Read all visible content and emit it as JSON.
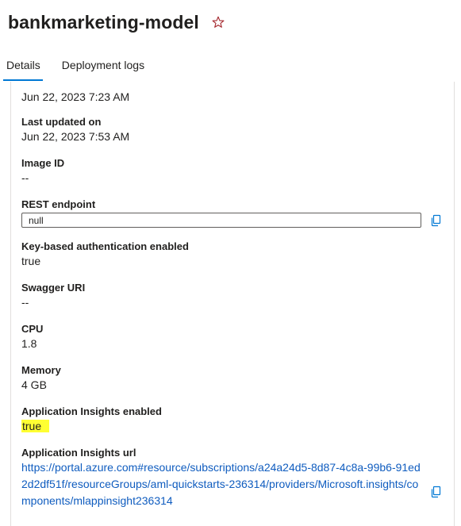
{
  "header": {
    "title": "bankmarketing-model"
  },
  "tabs": [
    {
      "label": "Details",
      "active": true
    },
    {
      "label": "Deployment logs",
      "active": false
    }
  ],
  "details": {
    "created_on_value": "Jun 22, 2023 7:23 AM",
    "last_updated": {
      "label": "Last updated on",
      "value": "Jun 22, 2023 7:53 AM"
    },
    "image_id": {
      "label": "Image ID",
      "value": "--"
    },
    "rest_endpoint": {
      "label": "REST endpoint",
      "value": "null"
    },
    "key_auth": {
      "label": "Key-based authentication enabled",
      "value": "true"
    },
    "swagger_uri": {
      "label": "Swagger URI",
      "value": "--"
    },
    "cpu": {
      "label": "CPU",
      "value": "1.8"
    },
    "memory": {
      "label": "Memory",
      "value": "4 GB"
    },
    "app_insights_enabled": {
      "label": "Application Insights enabled",
      "value": "true"
    },
    "app_insights_url": {
      "label": "Application Insights url",
      "value": "https://portal.azure.com#resource/subscriptions/a24a24d5-8d87-4c8a-99b6-91ed2d2df51f/resourceGroups/aml-quickstarts-236314/providers/Microsoft.insights/components/mlappinsight236314"
    }
  },
  "colors": {
    "accent": "#0078d4",
    "link": "#0f5cbf",
    "highlight": "#ffff33",
    "star": "#a4262c"
  },
  "icons": {
    "favorite": "star-outline-icon",
    "copy": "copy-icon"
  }
}
